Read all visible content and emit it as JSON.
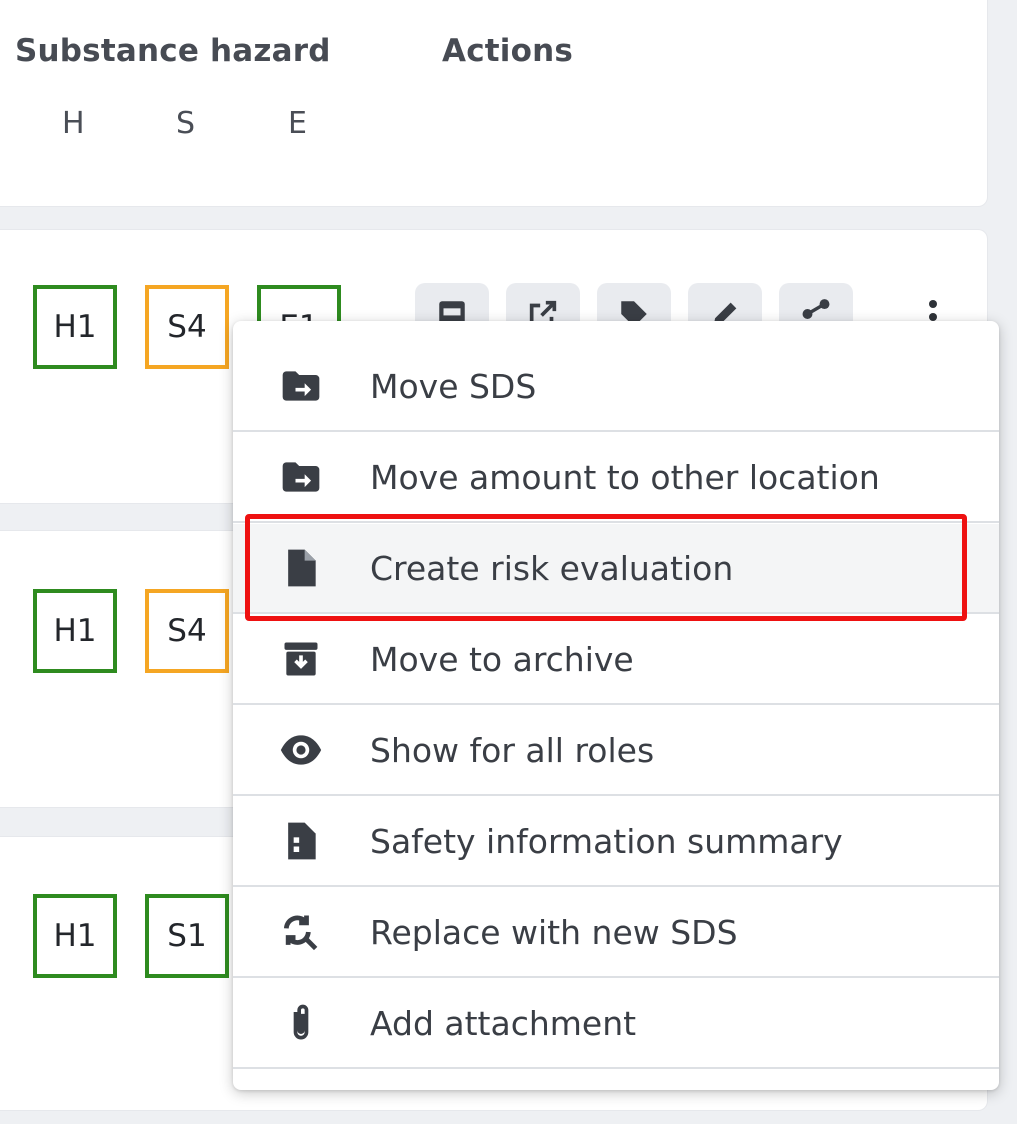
{
  "header": {
    "substance_hazard": "Substance hazard",
    "actions": "Actions",
    "sub_h": "H",
    "sub_s": "S",
    "sub_e": "E"
  },
  "rows": [
    {
      "h": "H1",
      "s": "S4",
      "e": "E1",
      "h_color": "#2e8b1f",
      "s_color": "#f5a623",
      "e_color": "#2e8b1f"
    },
    {
      "h": "H1",
      "s": "S4",
      "h_color": "#2e8b1f",
      "s_color": "#f5a623"
    },
    {
      "h": "H1",
      "s": "S1",
      "h_color": "#2e8b1f",
      "s_color": "#2e8b1f"
    }
  ],
  "action_icons": [
    "pdf-icon",
    "open-external-icon",
    "tag-icon",
    "edit-icon",
    "share-icon",
    "more-vertical-icon"
  ],
  "menu": {
    "items": [
      {
        "label": "Move SDS",
        "icon": "folder-move-icon"
      },
      {
        "label": "Move amount to other location",
        "icon": "folder-move-icon"
      },
      {
        "label": "Create risk evaluation",
        "icon": "file-icon",
        "highlighted": true
      },
      {
        "label": "Move to archive",
        "icon": "archive-icon"
      },
      {
        "label": "Show for all roles",
        "icon": "eye-icon"
      },
      {
        "label": "Safety information summary",
        "icon": "file-summary-icon"
      },
      {
        "label": "Replace with new SDS",
        "icon": "search-replace-icon"
      },
      {
        "label": "Add attachment",
        "icon": "paperclip-icon"
      }
    ]
  },
  "colors": {
    "highlight": "#ee1111",
    "green": "#2e8b1f",
    "orange": "#f5a623"
  }
}
